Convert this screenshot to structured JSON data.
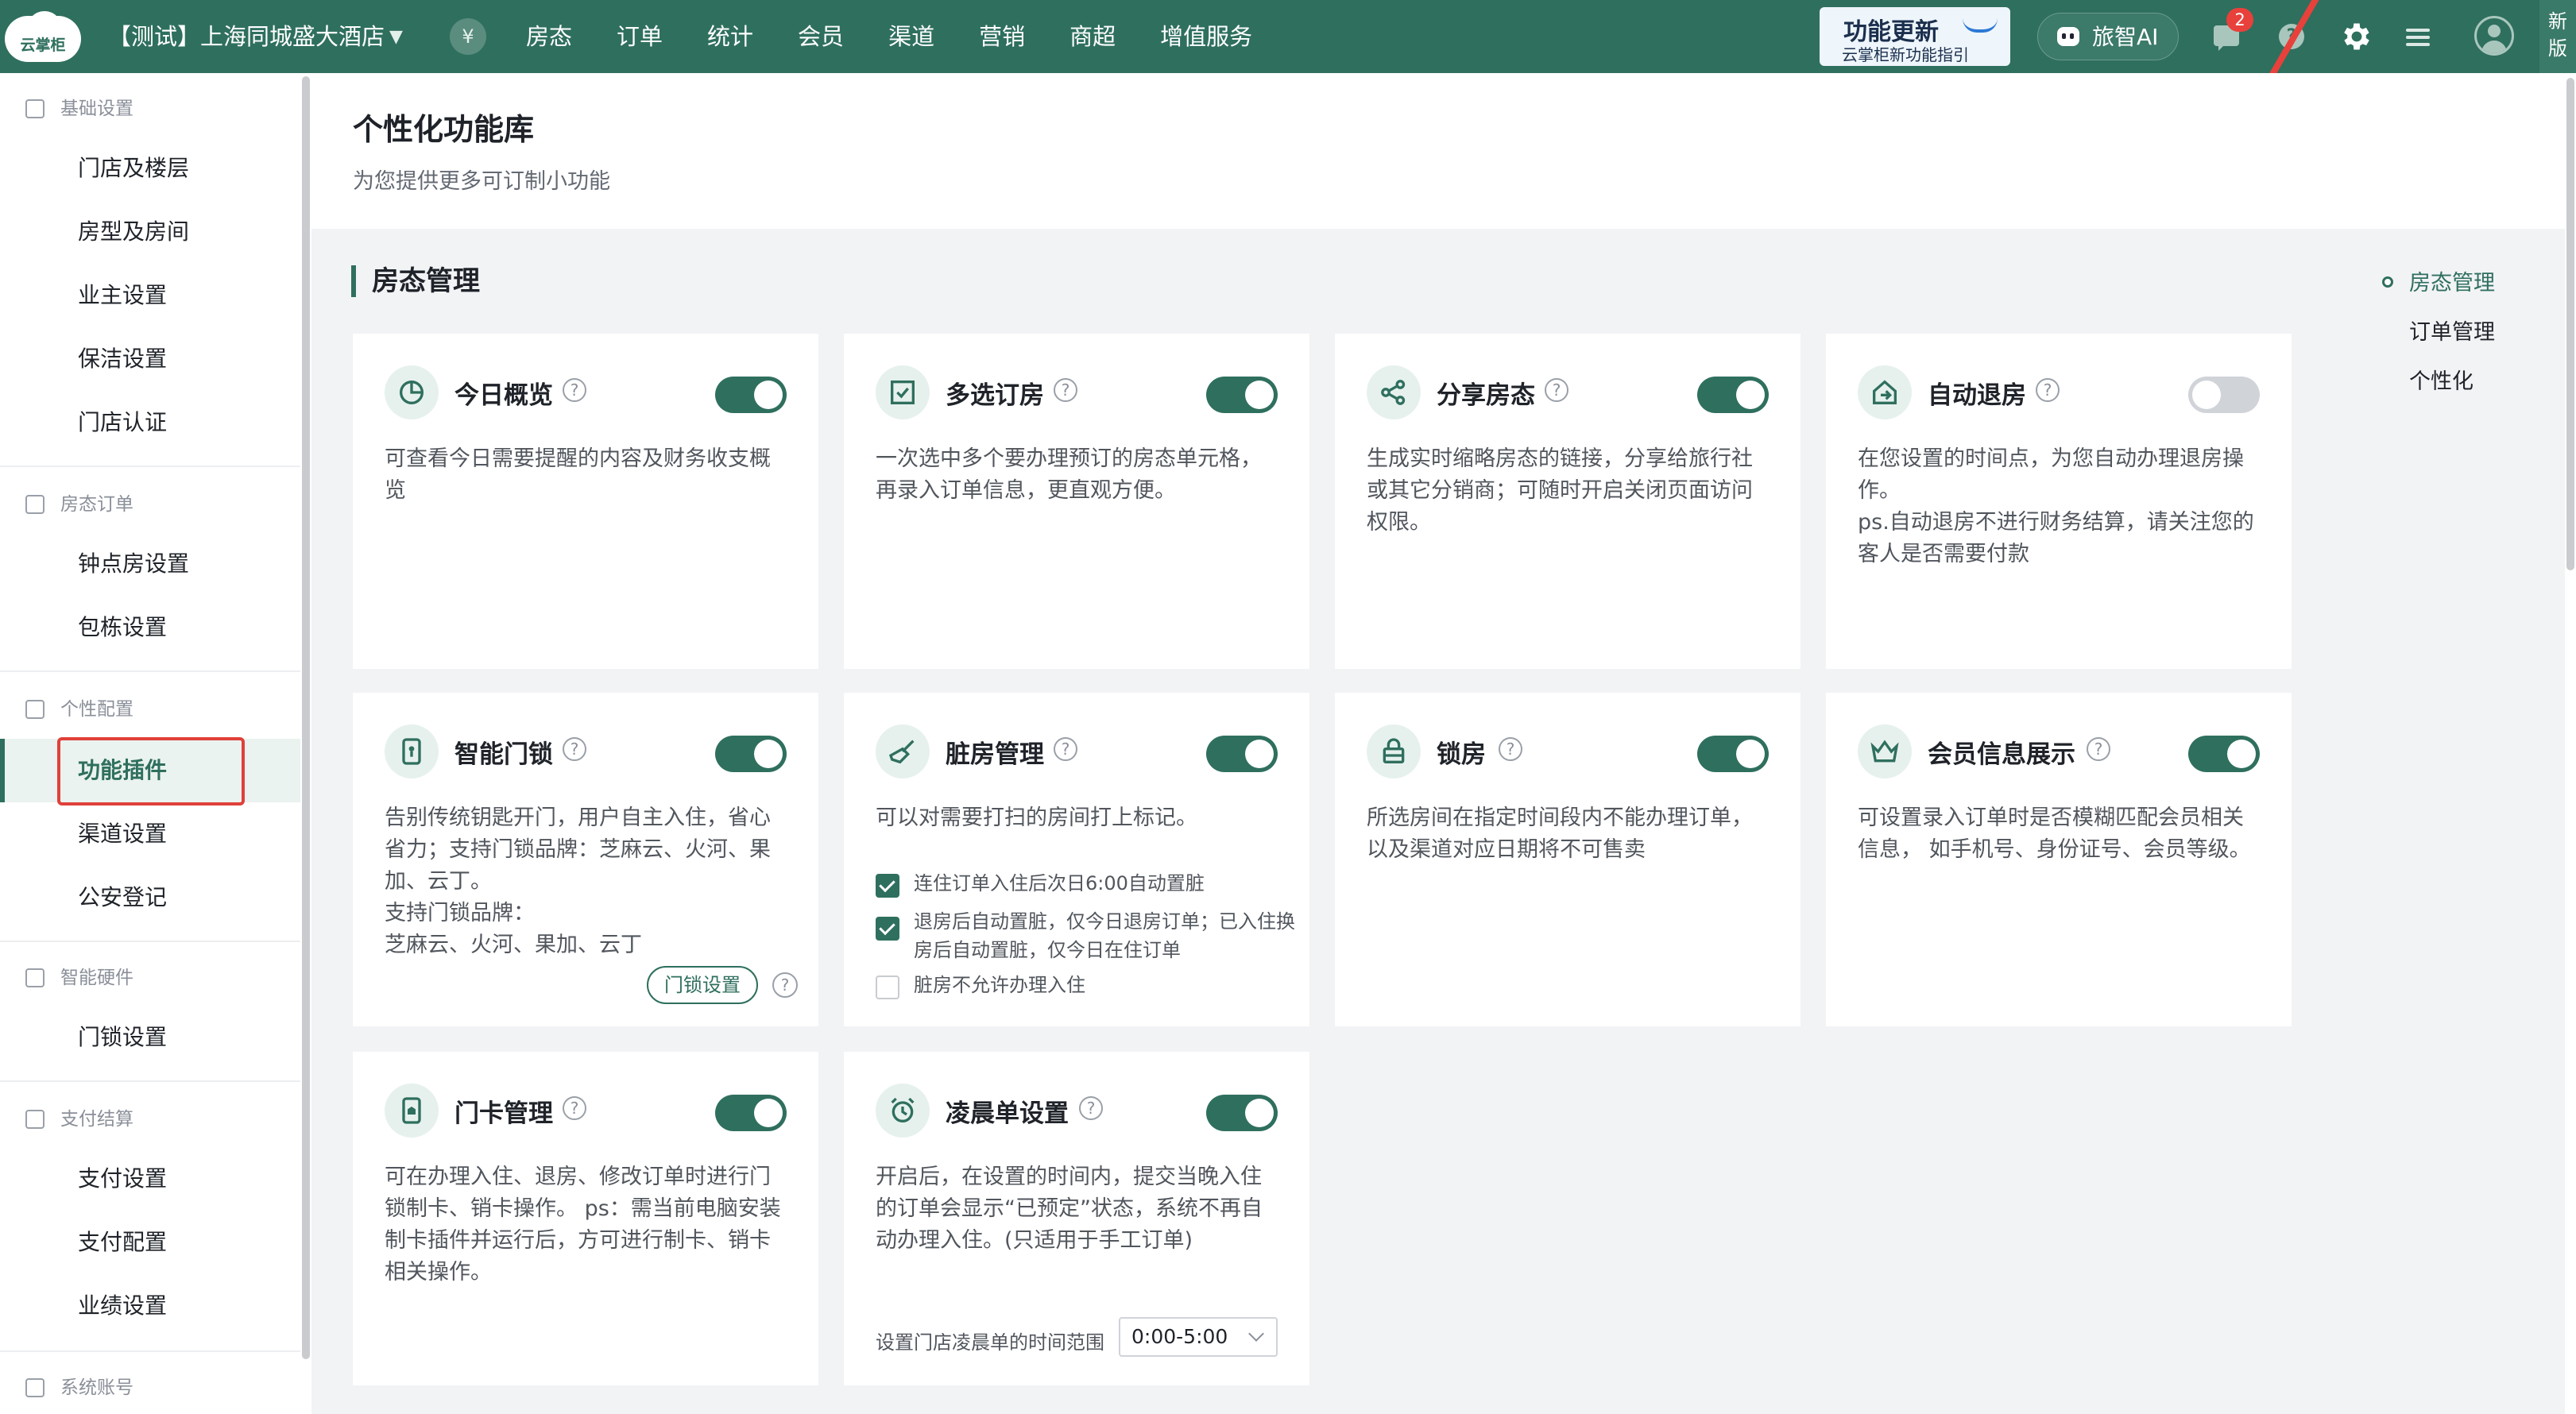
{
  "topbar": {
    "logo": "云掌柜",
    "store": "【测试】上海同城盛大酒店",
    "coin": "¥",
    "nav": [
      "房态",
      "订单",
      "统计",
      "会员",
      "渠道",
      "营销",
      "商超",
      "增值服务"
    ],
    "update_title": "功能更新",
    "update_sub": "云掌柜新功能指引",
    "ai_label": "旅智AI",
    "msg_badge": "2",
    "help": "?",
    "new_version": "新版"
  },
  "sidebar": {
    "groups": [
      {
        "label": "基础设置",
        "items": [
          "门店及楼层",
          "房型及房间",
          "业主设置",
          "保洁设置",
          "门店认证"
        ]
      },
      {
        "label": "房态订单",
        "items": [
          "钟点房设置",
          "包栋设置"
        ]
      },
      {
        "label": "个性配置",
        "items": [
          "功能插件",
          "渠道设置",
          "公安登记"
        ]
      },
      {
        "label": "智能硬件",
        "items": [
          "门锁设置"
        ]
      },
      {
        "label": "支付结算",
        "items": [
          "支付设置",
          "支付配置",
          "业绩设置"
        ]
      },
      {
        "label": "系统账号",
        "items": []
      }
    ],
    "active_item": "功能插件"
  },
  "header": {
    "title": "个性化功能库",
    "subtitle": "为您提供更多可订制小功能"
  },
  "section": {
    "title": "房态管理"
  },
  "cards": [
    {
      "title": "今日概览",
      "enabled": true,
      "desc": "可查看今日需要提醒的内容及财务收支概览"
    },
    {
      "title": "多选订房",
      "enabled": true,
      "desc": "一次选中多个要办理预订的房态单元格，再录入订单信息，更直观方便。"
    },
    {
      "title": "分享房态",
      "enabled": true,
      "desc": "生成实时缩略房态的链接，分享给旅行社或其它分销商；可随时开启关闭页面访问权限。"
    },
    {
      "title": "自动退房",
      "enabled": false,
      "desc": "在您设置的时间点，为您自动办理退房操作。",
      "desc2": "ps.自动退房不进行财务结算，请关注您的客人是否需要付款"
    },
    {
      "title": "智能门锁",
      "enabled": true,
      "desc": "告别传统钥匙开门，用户自主入住，省心省力；支持门锁品牌：芝麻云、火河、果加、云丁。",
      "desc2": "支持门锁品牌：",
      "desc3": "芝麻云、火河、果加、云丁",
      "button": "门锁设置"
    },
    {
      "title": "脏房管理",
      "enabled": true,
      "desc": "可以对需要打扫的房间打上标记。",
      "options": [
        {
          "label": "连住订单入住后次日6:00自动置脏",
          "checked": true
        },
        {
          "label": "退房后自动置脏，仅今日退房订单；已入住换房后自动置脏，仅今日在住订单",
          "checked": true
        },
        {
          "label": "脏房不允许办理入住",
          "checked": false
        }
      ]
    },
    {
      "title": "锁房",
      "enabled": true,
      "desc": "所选房间在指定时间段内不能办理订单，以及渠道对应日期将不可售卖"
    },
    {
      "title": "会员信息展示",
      "enabled": true,
      "desc": "可设置录入订单时是否模糊匹配会员相关信息， 如手机号、身份证号、会员等级。"
    },
    {
      "title": "门卡管理",
      "enabled": true,
      "desc": "可在办理入住、退房、修改订单时进行门锁制卡、销卡操作。 ps：需当前电脑安装制卡插件并运行后，方可进行制卡、销卡相关操作。"
    },
    {
      "title": "凌晨单设置",
      "enabled": true,
      "desc": "开启后，在设置的时间内，提交当晚入住的订单会显示“已预定”状态，系统不再自动办理入住。(只适用于手工订单)",
      "range_label": "设置门店凌晨单的时间范围",
      "range_value": "0:00-5:00"
    }
  ],
  "anchor_nav": [
    "房态管理",
    "订单管理",
    "个性化"
  ],
  "colors": {
    "brand": "#2f6f5e",
    "highlight": "#e0403a"
  }
}
